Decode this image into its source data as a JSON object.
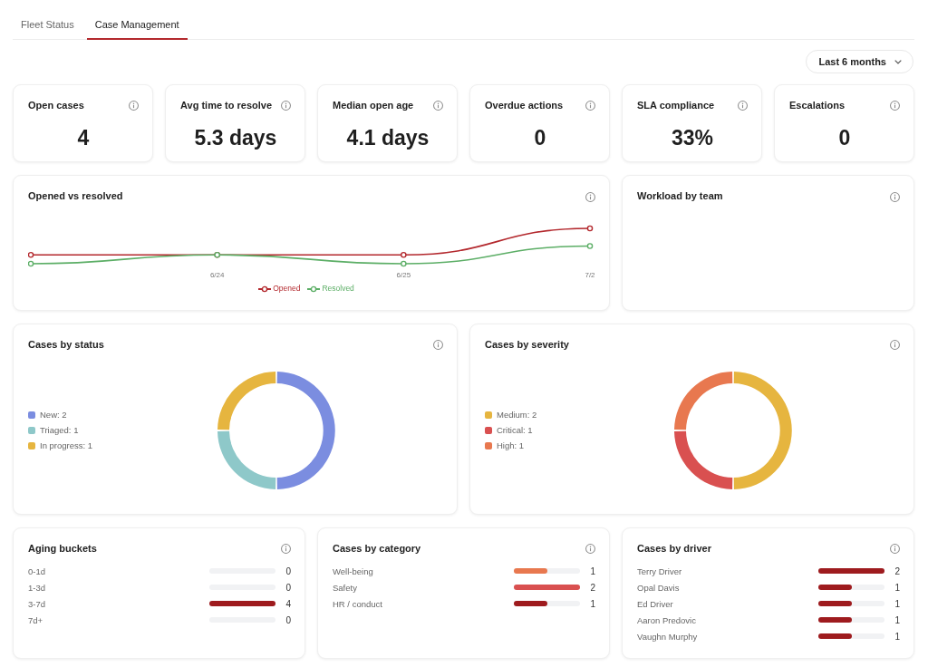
{
  "tabs": [
    {
      "label": "Fleet Status",
      "selected": false
    },
    {
      "label": "Case Management",
      "selected": true
    }
  ],
  "period_select": {
    "value": "Last 6 months"
  },
  "kpis": [
    {
      "title": "Open cases",
      "value": "4"
    },
    {
      "title": "Avg time to resolve",
      "value": "5.3 days"
    },
    {
      "title": "Median open age",
      "value": "4.1 days"
    },
    {
      "title": "Overdue actions",
      "value": "0"
    },
    {
      "title": "SLA compliance",
      "value": "33%"
    },
    {
      "title": "Escalations",
      "value": "0"
    }
  ],
  "panels": [
    {
      "kind": "line",
      "title": "Opened vs resolved",
      "x_labels": [
        "6/24",
        "6/25",
        "7/2"
      ],
      "legend": [
        {
          "label": "Opened",
          "color": "#b3282d"
        },
        {
          "label": "Resolved",
          "color": "#5cae66"
        }
      ]
    },
    {
      "kind": "blank",
      "title": "Workload by team"
    },
    {
      "kind": "donut",
      "title": "Cases by status",
      "chart_data": {
        "type": "donut",
        "legend": "left",
        "categories": [
          "New: 2",
          "Triaged: 1",
          "In progress: 1"
        ],
        "values": [
          2,
          1,
          1
        ],
        "colors": [
          "#7b8de0",
          "#8ec8c9",
          "#e6b53f"
        ]
      }
    },
    {
      "kind": "donut",
      "title": "Cases by severity",
      "chart_data": {
        "type": "donut",
        "legend": "left",
        "categories": [
          "Medium: 2",
          "Critical: 1",
          "High: 1"
        ],
        "values": [
          2,
          1,
          1
        ],
        "colors": [
          "#e6b53f",
          "#d95050",
          "#e8784f"
        ]
      }
    },
    {
      "kind": "bars",
      "title": "Aging buckets",
      "rows": [
        {
          "label": "0-1d",
          "value": "0"
        },
        {
          "label": "1-3d",
          "value": "0"
        },
        {
          "label": "3-7d",
          "value": "4",
          "level": 1
        },
        {
          "label": "7d+",
          "value": "0"
        }
      ]
    },
    {
      "kind": "bars",
      "title": "Cases by category",
      "rows": [
        {
          "label": "Well-being",
          "value": "1",
          "level": 0.5,
          "color": "#e8784f"
        },
        {
          "label": "Safety",
          "value": "2",
          "level": 1,
          "color": "#d95050"
        },
        {
          "label": "HR / conduct",
          "value": "1",
          "level": 0.5,
          "color": "#9e1b1e"
        }
      ]
    },
    {
      "kind": "bars",
      "title": "Cases by driver",
      "rows": [
        {
          "label": "Terry Driver",
          "value": "2",
          "level": 1
        },
        {
          "label": "Opal Davis",
          "value": "1",
          "level": 0.5
        },
        {
          "label": "Ed Driver",
          "value": "1",
          "level": 0.5
        },
        {
          "label": "Aaron Predovic",
          "value": "1",
          "level": 0.5
        },
        {
          "label": "Vaughn Murphy",
          "value": "1",
          "level": 0.5
        }
      ]
    }
  ]
}
